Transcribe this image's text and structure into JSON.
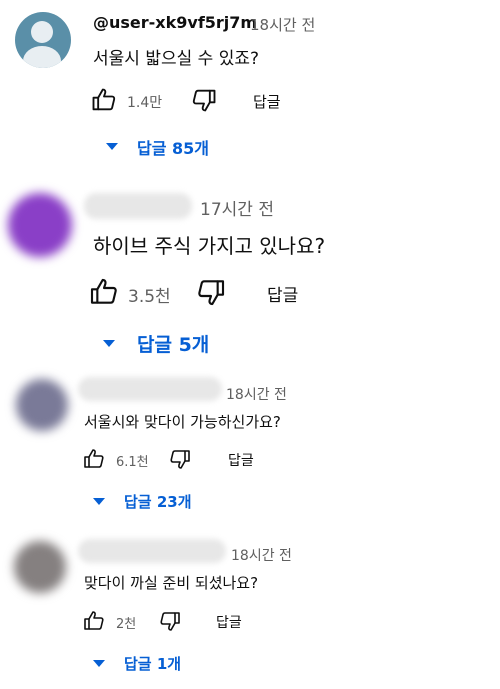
{
  "comments": [
    {
      "author": "@user-xk9vf5rj7m",
      "time": "18시간 전",
      "text": "서울시 밟으실 수 있죠?",
      "likes": "1.4만",
      "reply_label": "답글",
      "replies_label": "답글 85개",
      "avatar": "default-user-avatar",
      "avatar_color": "#5a8fa8"
    },
    {
      "author": "",
      "time": "17시간 전",
      "text": "하이브 주식 가지고 있나요?",
      "likes": "3.5천",
      "reply_label": "답글",
      "replies_label": "답글 5개",
      "avatar": "blurred-avatar",
      "avatar_color": "#8a3fc7"
    },
    {
      "author": "",
      "time": "18시간 전",
      "text": "서울시와 맞다이 가능하신가요?",
      "likes": "6.1천",
      "reply_label": "답글",
      "replies_label": "답글 23개",
      "avatar": "blurred-avatar",
      "avatar_color": "#7a7a98"
    },
    {
      "author": "",
      "time": "18시간 전",
      "text": "맞다이 까실 준비 되셨나요?",
      "likes": "2천",
      "reply_label": "답글",
      "replies_label": "답글 1개",
      "avatar": "blurred-avatar",
      "avatar_color": "#858080"
    }
  ],
  "icons": {
    "like": "thumbs-up-icon",
    "dislike": "thumbs-down-icon",
    "expand": "caret-down-icon"
  },
  "colors": {
    "link": "#065fd4",
    "secondary_text": "#606060"
  }
}
